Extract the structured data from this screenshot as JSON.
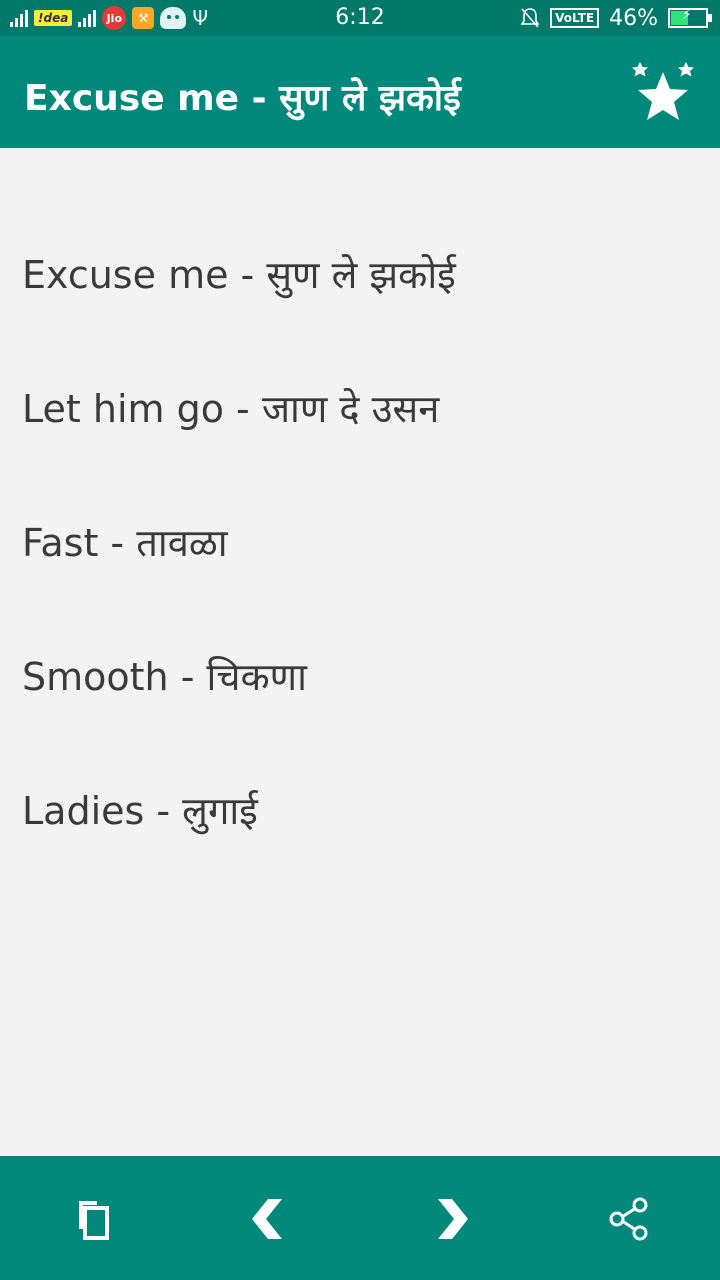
{
  "status_bar": {
    "time": "6:12",
    "carrier1": "!dea",
    "carrier2": "Jio",
    "volte": "VoLTE",
    "battery_percent": "46%",
    "battery_level": 0.46
  },
  "app_bar": {
    "title": "Excuse me - सुण ले झकोई",
    "rate_icon": "stars-icon"
  },
  "phrases": [
    "Excuse me - सुण ले झकोई",
    "Let him go - जाण दे उसन",
    "Fast - तावळा",
    "Smooth - चिकणा",
    "Ladies - लुगाई"
  ],
  "bottom_bar": {
    "icons": [
      "copy-icon",
      "previous-icon",
      "next-icon",
      "share-icon"
    ]
  },
  "colors": {
    "primary": "#00897b",
    "status": "#00796b",
    "background": "#f3f3f3",
    "text": "#3a3a3a"
  }
}
